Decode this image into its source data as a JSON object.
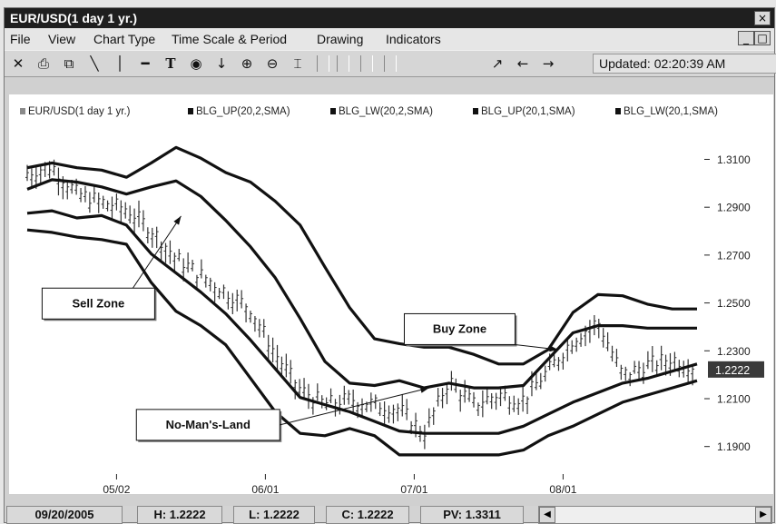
{
  "window": {
    "title": "EUR/USD(1 day  1 yr.)",
    "close_glyph": "×",
    "minimize_glyph": "_",
    "maximize_glyph": "□"
  },
  "menu": [
    "File",
    "View",
    "Chart Type",
    "Time Scale & Period",
    "Drawing",
    "Indicators"
  ],
  "toolbar": {
    "icons": [
      "close-chart-icon",
      "print-icon",
      "copy-icon",
      "trendline-icon",
      "vertical-line-icon",
      "horizontal-line-icon",
      "text-tool-icon",
      "circle-tool-icon",
      "arrow-down-icon",
      "zoom-in-icon",
      "zoom-out-icon",
      "fit-icon"
    ],
    "icons2": [
      "draw-line-icon",
      "arrow-left-icon",
      "arrow-right-icon"
    ],
    "updated": "Updated: 02:20:39 AM"
  },
  "chart_data": {
    "type": "line",
    "legend": [
      "EUR/USD(1 day  1 yr.)",
      "BLG_UP(20,2,SMA)",
      "BLG_LW(20,2,SMA)",
      "BLG_UP(20,1,SMA)",
      "BLG_LW(20,1,SMA)"
    ],
    "legend_marker_colors": [
      "#8a8a8a",
      "#111111",
      "#111111",
      "#111111",
      "#111111"
    ],
    "x_tick_labels": [
      "05/02",
      "06/01",
      "07/01",
      "08/01"
    ],
    "y_tick_labels": [
      "1.3100",
      "1.2900",
      "1.2700",
      "1.2500",
      "1.2300",
      "1.2100",
      "1.1900"
    ],
    "y_ticks": [
      1.31,
      1.29,
      1.27,
      1.25,
      1.23,
      1.21,
      1.19
    ],
    "ylim": [
      1.1785,
      1.3265
    ],
    "x_range_days": [
      0,
      135
    ],
    "x_tick_days": [
      18,
      48,
      78,
      108
    ],
    "last_price_label": "1.2222",
    "last_price": 1.2222,
    "series": [
      {
        "name": "BLG_UP(20,2,SMA)",
        "days": [
          0,
          5,
          10,
          15,
          20,
          25,
          30,
          35,
          40,
          45,
          50,
          55,
          60,
          65,
          70,
          75,
          80,
          85,
          90,
          95,
          100,
          105,
          110,
          115,
          120,
          125,
          130,
          135
        ],
        "values": [
          1.3065,
          1.3085,
          1.3065,
          1.3055,
          1.3025,
          1.3085,
          1.315,
          1.3105,
          1.3045,
          1.3005,
          1.2925,
          1.2825,
          1.265,
          1.248,
          1.235,
          1.233,
          1.2315,
          1.2315,
          1.2285,
          1.2245,
          1.2245,
          1.2305,
          1.246,
          1.2535,
          1.253,
          1.2495,
          1.2475,
          1.2475
        ]
      },
      {
        "name": "BLG_UP(20,1,SMA)",
        "days": [
          0,
          5,
          10,
          15,
          20,
          25,
          30,
          35,
          40,
          45,
          50,
          55,
          60,
          65,
          70,
          75,
          80,
          85,
          90,
          95,
          100,
          105,
          110,
          115,
          120,
          125,
          130,
          135
        ],
        "values": [
          1.2975,
          1.3015,
          1.3005,
          1.2985,
          1.2955,
          1.2985,
          1.301,
          1.2945,
          1.2845,
          1.2735,
          1.2605,
          1.2435,
          1.2255,
          1.2165,
          1.2155,
          1.2175,
          1.2145,
          1.2165,
          1.2145,
          1.2145,
          1.2155,
          1.2265,
          1.2375,
          1.2405,
          1.2405,
          1.2395,
          1.2395,
          1.2395
        ]
      },
      {
        "name": "BLG_LW(20,1,SMA)",
        "days": [
          0,
          5,
          10,
          15,
          20,
          25,
          30,
          35,
          40,
          45,
          50,
          55,
          60,
          65,
          70,
          75,
          80,
          85,
          90,
          95,
          100,
          105,
          110,
          115,
          120,
          125,
          130,
          135
        ],
        "values": [
          1.2875,
          1.2885,
          1.2855,
          1.2865,
          1.2825,
          1.2705,
          1.2625,
          1.2545,
          1.2455,
          1.2345,
          1.2225,
          1.2105,
          1.2075,
          1.2045,
          1.2005,
          1.1965,
          1.1955,
          1.1955,
          1.1955,
          1.1955,
          1.1985,
          1.2035,
          1.2085,
          1.2125,
          1.2165,
          1.2185,
          1.2215,
          1.2245
        ]
      },
      {
        "name": "BLG_LW(20,2,SMA)",
        "days": [
          0,
          5,
          10,
          15,
          20,
          25,
          30,
          35,
          40,
          45,
          50,
          55,
          60,
          65,
          70,
          75,
          80,
          85,
          90,
          95,
          100,
          105,
          110,
          115,
          120,
          125,
          130,
          135
        ],
        "values": [
          1.2805,
          1.2795,
          1.2775,
          1.2765,
          1.2745,
          1.2585,
          1.2465,
          1.2405,
          1.2325,
          1.2185,
          1.2045,
          1.1955,
          1.1945,
          1.1975,
          1.1945,
          1.1865,
          1.1865,
          1.1865,
          1.1865,
          1.1865,
          1.1885,
          1.1945,
          1.1985,
          1.2035,
          1.2085,
          1.2115,
          1.2145,
          1.2175
        ]
      }
    ],
    "price_path": {
      "days": [
        0,
        5,
        10,
        15,
        20,
        25,
        30,
        35,
        40,
        45,
        50,
        55,
        60,
        65,
        70,
        75,
        80,
        85,
        90,
        95,
        100,
        105,
        110,
        115,
        120,
        125,
        130,
        135
      ],
      "values": [
        1.3035,
        1.3065,
        1.295,
        1.2915,
        1.2885,
        1.28,
        1.268,
        1.261,
        1.254,
        1.247,
        1.228,
        1.213,
        1.207,
        1.209,
        1.207,
        1.205,
        1.195,
        1.217,
        1.207,
        1.211,
        1.209,
        1.221,
        1.234,
        1.2415,
        1.219,
        1.2235,
        1.226,
        1.2222
      ]
    },
    "annotations": [
      {
        "text": "Sell Zone",
        "box_value": 1.2562,
        "box_day": 3,
        "arrow_to_day": 31,
        "arrow_to_value": 1.2863
      },
      {
        "text": "Buy Zone",
        "box_value": 1.2455,
        "box_day": 76,
        "arrow_to_day": 107,
        "arrow_to_value": 1.2305
      },
      {
        "text": "No-Man's-Land",
        "box_value": 1.2055,
        "box_day": 22,
        "arrow_to_day": 81,
        "arrow_to_value": 1.2145
      }
    ]
  },
  "status": {
    "date": "09/20/2005",
    "high": "H: 1.2222",
    "low": "L: 1.2222",
    "close": "C: 1.2222",
    "pv": "PV: 1.3311",
    "scroll_left": "◀",
    "scroll_right": "▶"
  }
}
